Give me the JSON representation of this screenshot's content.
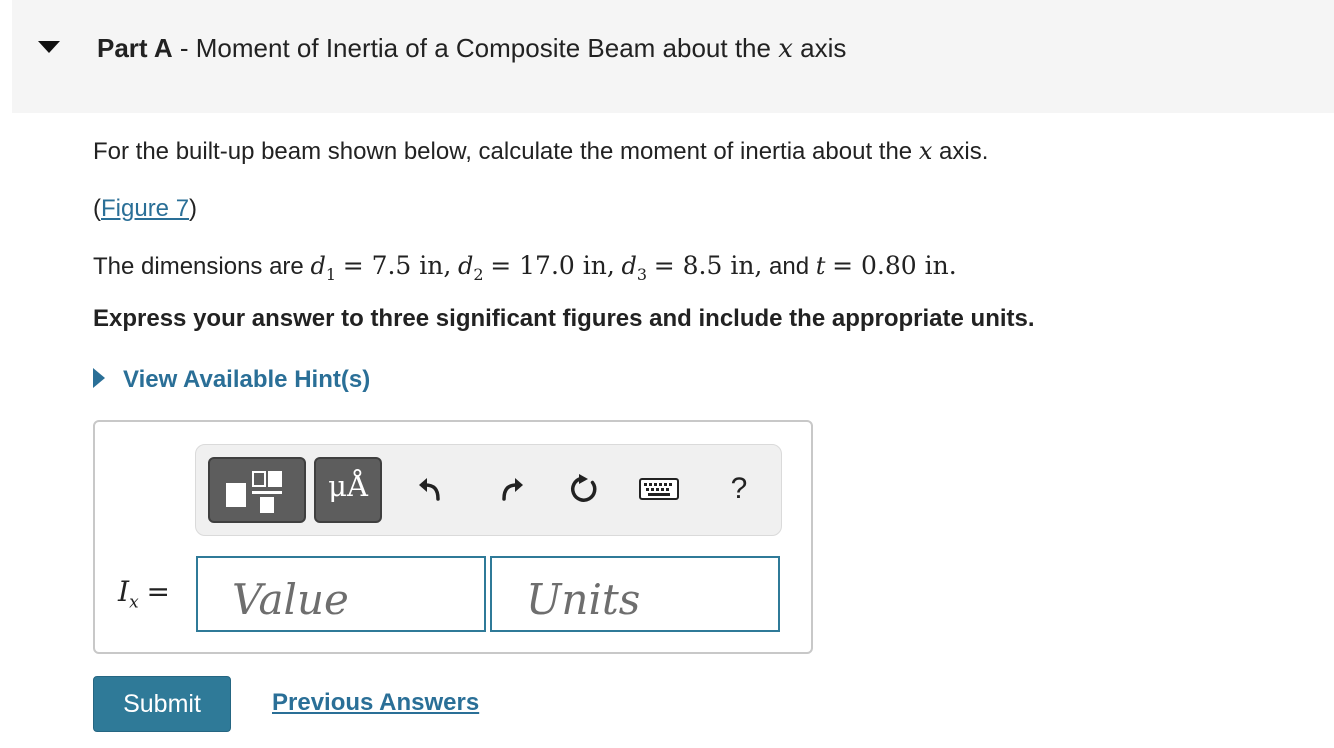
{
  "part": {
    "label": "Part A",
    "separator": "-",
    "title_text": "Moment of Inertia of a Composite Beam about the",
    "title_var": "x",
    "title_end": "axis"
  },
  "question": {
    "prompt_pre": "For the built-up beam shown below, calculate the moment of inertia about the",
    "prompt_var": "x",
    "prompt_post": "axis.",
    "figure_open": "(",
    "figure_link": "Figure 7",
    "figure_close": ")",
    "dims_intro": "The dimensions are",
    "d1_sym": "d",
    "d1_sub": "1",
    "d1_val": "= 7.5 in,",
    "d2_sym": "d",
    "d2_sub": "2",
    "d2_val": "= 17.0 in,",
    "d3_sym": "d",
    "d3_sub": "3",
    "d3_val": "= 8.5 in,",
    "and_text": "and",
    "t_sym": "t",
    "t_val": "= 0.80 in.",
    "instruction": "Express your answer to three significant figures and include the appropriate units."
  },
  "hints": {
    "label": "View Available Hint(s)"
  },
  "toolbar": {
    "units_symbol": "μÅ",
    "help_symbol": "?",
    "icons": [
      "templates-icon",
      "undo-icon",
      "redo-icon",
      "reset-icon",
      "keyboard-icon",
      "help-icon"
    ]
  },
  "answer": {
    "lhs_var": "I",
    "lhs_sub": "x",
    "equals": "=",
    "value_placeholder": "Value",
    "units_placeholder": "Units"
  },
  "actions": {
    "submit_label": "Submit",
    "previous_label": "Previous Answers"
  },
  "colors": {
    "accent": "#2f7a98",
    "link": "#2a6f97",
    "header_bg": "#f5f5f5",
    "toolbar_button": "#5d5d5d"
  }
}
